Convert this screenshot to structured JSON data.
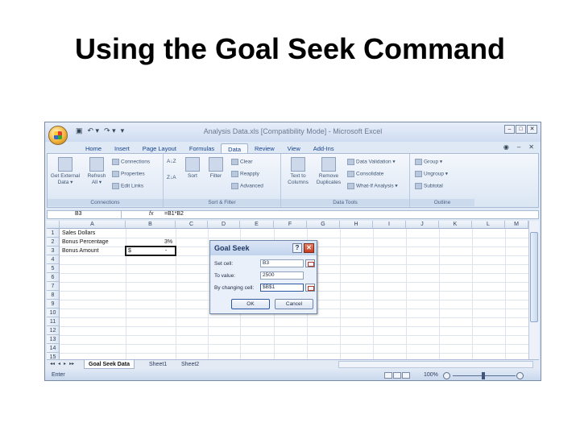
{
  "slide": {
    "title": "Using the Goal Seek Command"
  },
  "window": {
    "title": "Analysis Data.xls  [Compatibility Mode]  -  Microsoft Excel",
    "qat": [
      "▣",
      "↶ ▾",
      "↷ ▾",
      "▾"
    ],
    "controls": [
      "–",
      "□",
      "✕"
    ]
  },
  "ribbon": {
    "tabs": [
      "Home",
      "Insert",
      "Page Layout",
      "Formulas",
      "Data",
      "Review",
      "View",
      "Add-Ins"
    ],
    "active_tab": "Data",
    "tab_right": [
      "◉",
      "–",
      "✕"
    ],
    "groups": {
      "connections": {
        "label": "Connections",
        "get_external": "Get External",
        "get_external2": "Data ▾",
        "refresh": "Refresh",
        "refresh2": "All ▾",
        "connections": "Connections",
        "properties": "Properties",
        "edit_links": "Edit Links"
      },
      "sort_filter": {
        "label": "Sort & Filter",
        "sort": "Sort",
        "filter": "Filter",
        "clear": "Clear",
        "reapply": "Reapply",
        "advanced": "Advanced",
        "az": "A↓Z",
        "za": "Z↓A"
      },
      "data_tools": {
        "label": "Data Tools",
        "text_to": "Text to",
        "columns": "Columns",
        "remove": "Remove",
        "duplicates": "Duplicates",
        "validation": "Data Validation ▾",
        "consolidate": "Consolidate",
        "whatif": "What-If Analysis ▾"
      },
      "outline": {
        "label": "Outline",
        "group": "Group ▾",
        "ungroup": "Ungroup ▾",
        "subtotal": "Subtotal"
      }
    }
  },
  "formula_bar": {
    "name_box": "B3",
    "fx": "fx",
    "formula": "=B1*B2"
  },
  "sheet": {
    "columns": [
      "A",
      "B",
      "C",
      "D",
      "E",
      "F",
      "G",
      "H",
      "I",
      "J",
      "K",
      "L",
      "M"
    ],
    "rows": [
      "1",
      "2",
      "3",
      "4",
      "5",
      "6",
      "7",
      "8",
      "9",
      "10",
      "11",
      "12",
      "13",
      "14",
      "15"
    ],
    "cells": {
      "A1": "Sales Dollars",
      "A2": "Bonus Percentage",
      "A3": "Bonus Amount",
      "B2": "3%",
      "B3_currency": "$",
      "B3_value": "-"
    }
  },
  "sheet_tabs": {
    "nav": [
      "◂◂",
      "◂",
      "▸",
      "▸▸"
    ],
    "tabs": [
      "Goal Seek Data",
      "Sheet1",
      "Sheet2"
    ],
    "active": "Goal Seek Data"
  },
  "status": {
    "mode": "Enter",
    "zoom": "100%"
  },
  "goal_seek": {
    "title": "Goal Seek",
    "help": "?",
    "close": "✕",
    "set_cell_label": "Set cell:",
    "set_cell_value": "B3",
    "to_value_label": "To value:",
    "to_value_value": "2500",
    "changing_label": "By changing cell:",
    "changing_value": "$B$1",
    "ok": "OK",
    "cancel": "Cancel"
  }
}
